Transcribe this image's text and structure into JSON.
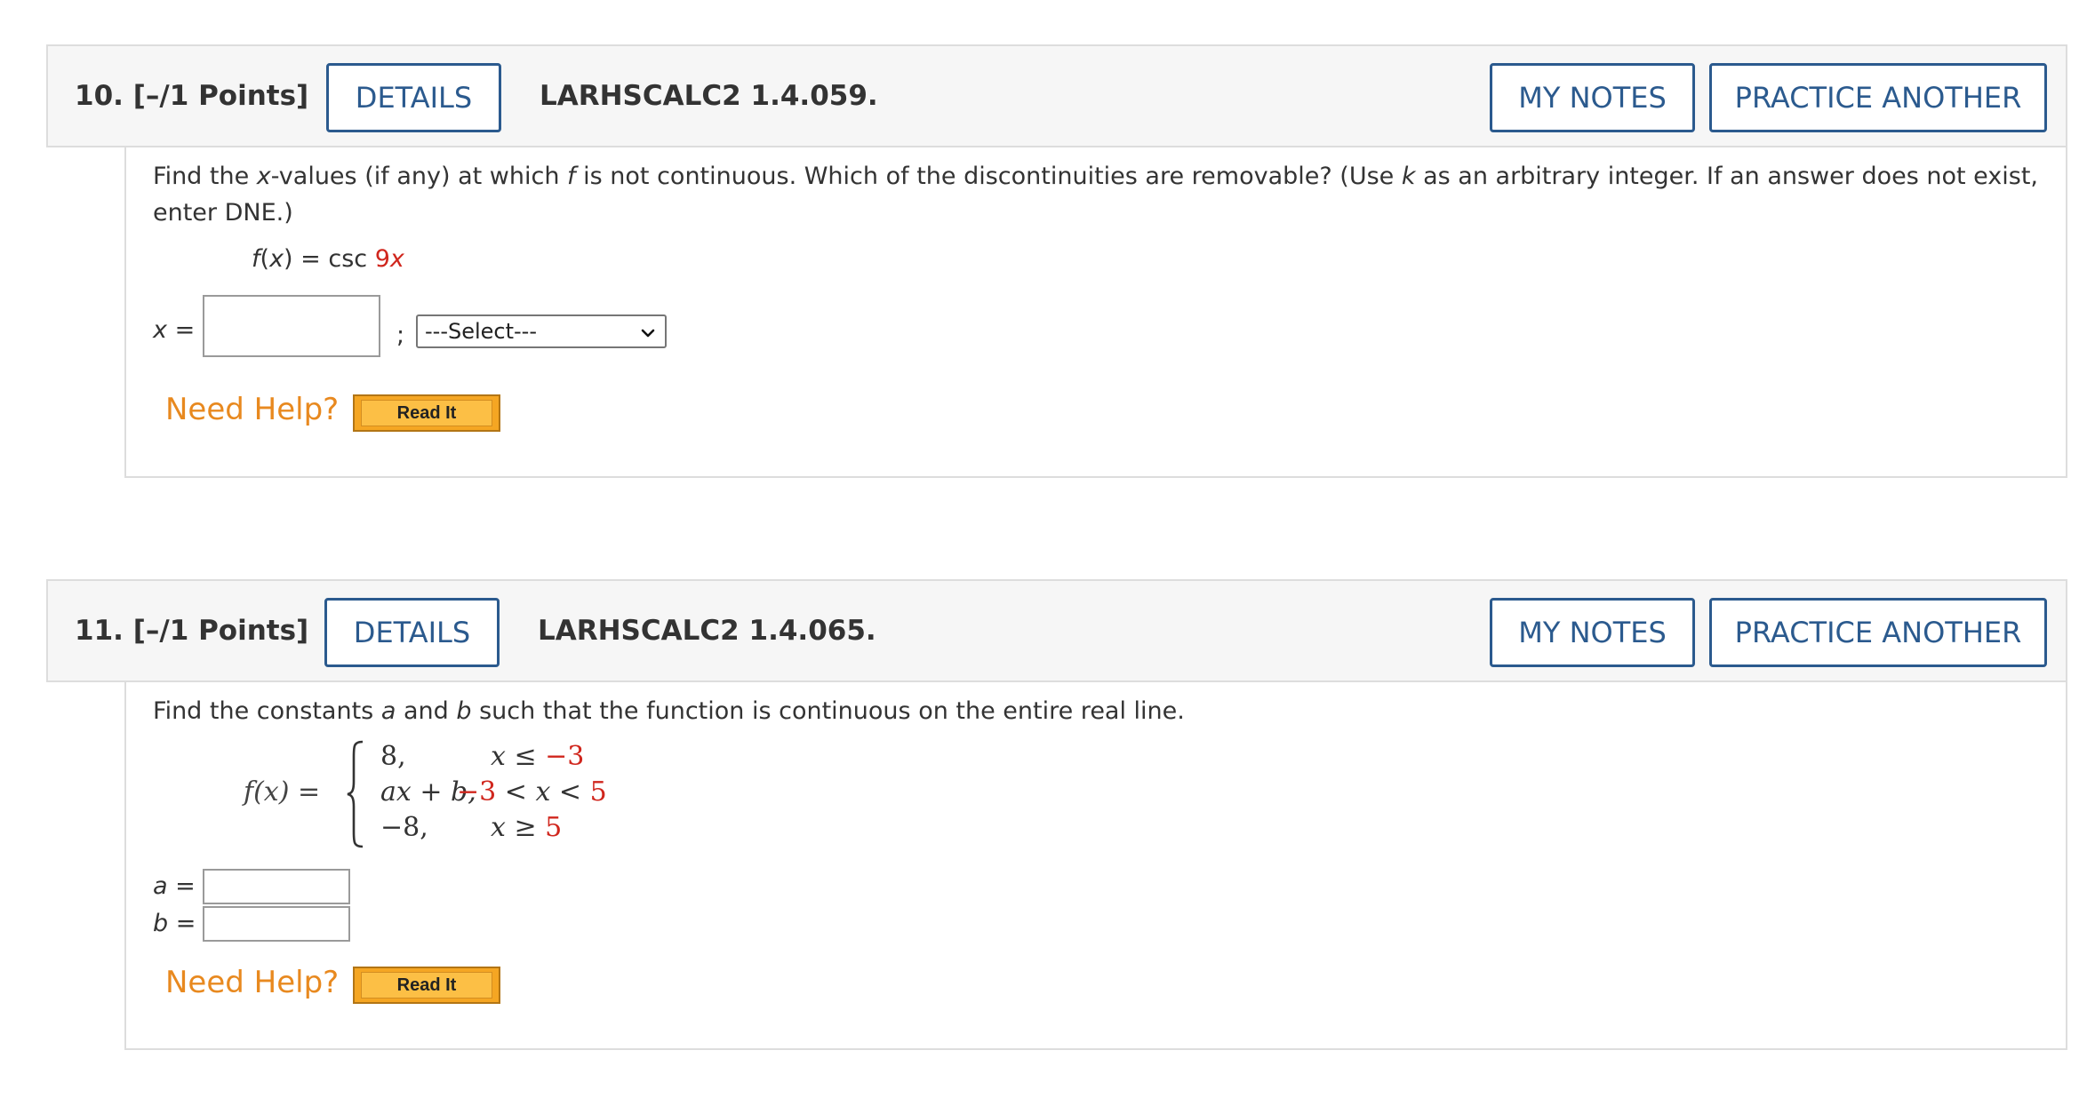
{
  "questions": [
    {
      "number": "10.",
      "points": "[–/1 Points]",
      "details_label": "DETAILS",
      "code": "LARHSCALC2 1.4.059.",
      "my_notes_label": "MY NOTES",
      "practice_label": "PRACTICE ANOTHER",
      "prompt_parts": {
        "p1": "Find the ",
        "x": "x",
        "p2": "-values (if any) at which ",
        "f": "f",
        "p3": " is not continuous. Which of the discontinuities are removable? (Use ",
        "k": "k",
        "p4": " as an arbitrary integer. If an answer does not exist, enter DNE.)"
      },
      "function": {
        "lhs": "f",
        "paren_open": "(",
        "var": "x",
        "paren_close": ")",
        "eq": " = csc ",
        "coef": "9",
        "arg": "x"
      },
      "answer_label": "x",
      "answer_eq": " =",
      "answer_value": "",
      "separator": ";",
      "select_value": "---Select---",
      "need_help": "Need Help?",
      "read_it": "Read It"
    },
    {
      "number": "11.",
      "points": "[–/1 Points]",
      "details_label": "DETAILS",
      "code": "LARHSCALC2 1.4.065.",
      "my_notes_label": "MY NOTES",
      "practice_label": "PRACTICE ANOTHER",
      "prompt_parts": {
        "p1": "Find the constants ",
        "a": "a",
        "p2": " and ",
        "b": "b",
        "p3": " such that the function is continuous on the entire real line."
      },
      "piecewise": {
        "lhs": "f(x) =",
        "cases": [
          {
            "expr": "8,",
            "cond_left": "x ≤ ",
            "cond_value": "−3"
          },
          {
            "expr": "ax + b,",
            "cond_left_value": "−3",
            "cond_mid": " < x < ",
            "cond_value": "5"
          },
          {
            "expr": "−8,",
            "cond_left": "x ≥ ",
            "cond_value": "5"
          }
        ]
      },
      "answers": [
        {
          "label": "a",
          "eq": " =",
          "value": ""
        },
        {
          "label": "b",
          "eq": " =",
          "value": ""
        }
      ],
      "need_help": "Need Help?",
      "read_it": "Read It"
    }
  ],
  "colors": {
    "button_text": "#2b5a8e",
    "need_help": "#e8891f",
    "highlight_red": "#d0261d",
    "header_bg": "#f6f6f6"
  }
}
